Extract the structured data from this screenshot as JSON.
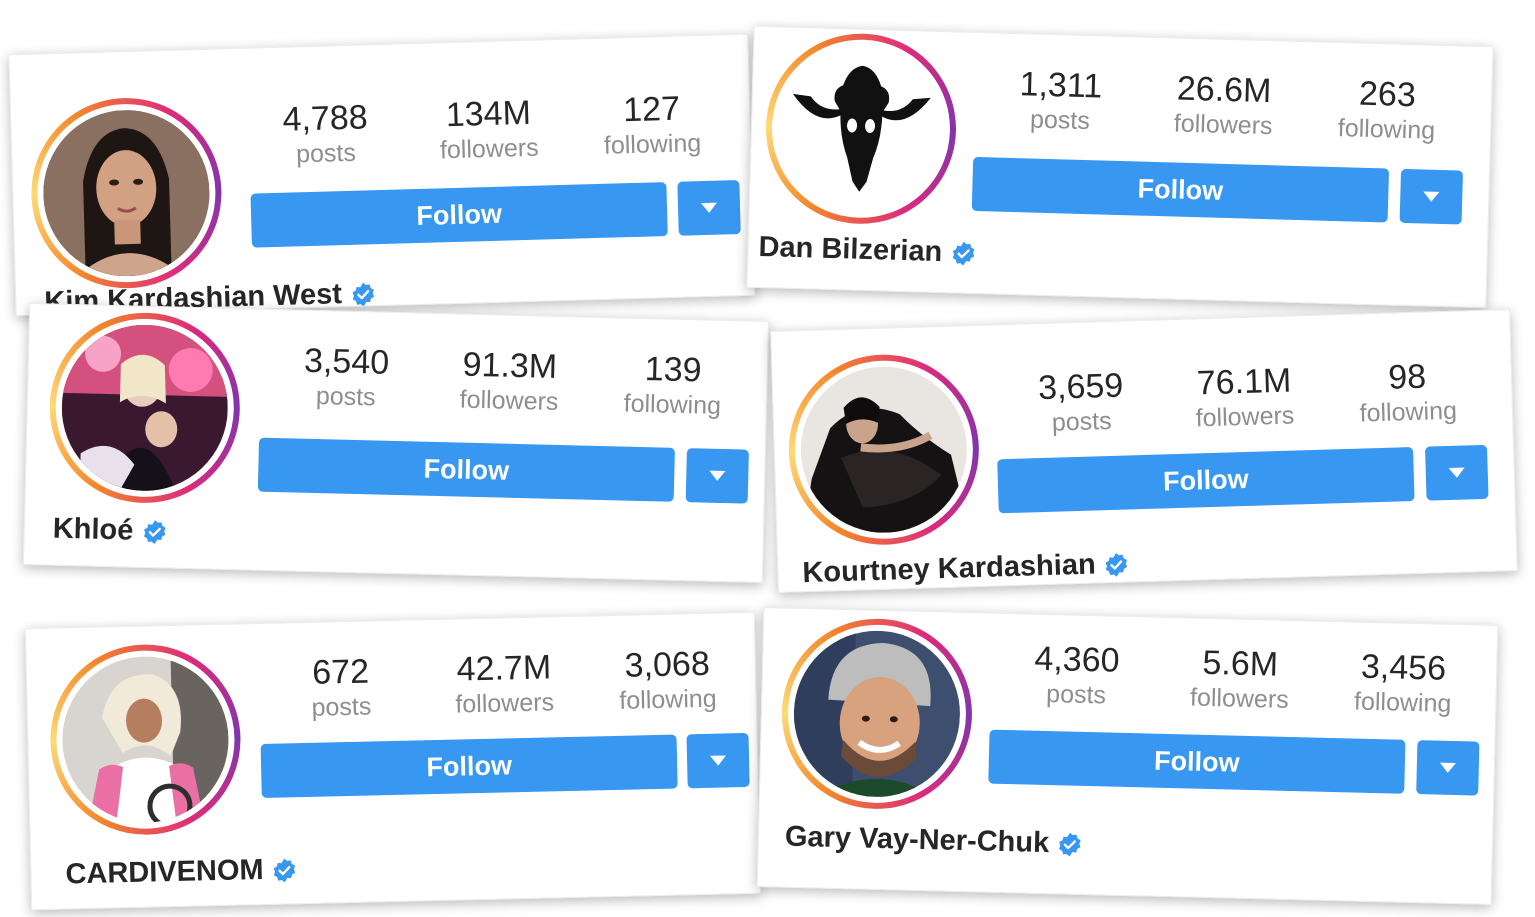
{
  "colors": {
    "follow_blue": "#3897f0",
    "verified_blue": "#3897f0",
    "text_dark": "#262626",
    "text_muted": "#8e8e8e"
  },
  "labels": {
    "posts": "posts",
    "followers": "followers",
    "following": "following",
    "follow": "Follow"
  },
  "profiles": [
    {
      "name": "Kim Kardashian West",
      "verified": true,
      "posts": "4,788",
      "followers": "134M",
      "following": "127",
      "avatar_icon": "portrait-photo"
    },
    {
      "name": "Dan Bilzerian",
      "verified": true,
      "posts": "1,311",
      "followers": "26.6M",
      "following": "263",
      "avatar_icon": "goat-skull-logo"
    },
    {
      "name": "Khloé",
      "verified": true,
      "posts": "3,540",
      "followers": "91.3M",
      "following": "139",
      "avatar_icon": "portrait-photo"
    },
    {
      "name": "Kourtney Kardashian",
      "verified": true,
      "posts": "3,659",
      "followers": "76.1M",
      "following": "98",
      "avatar_icon": "portrait-photo"
    },
    {
      "name": "CARDIVENOM",
      "verified": true,
      "posts": "672",
      "followers": "42.7M",
      "following": "3,068",
      "avatar_icon": "portrait-photo"
    },
    {
      "name": "Gary Vay-Ner-Chuk",
      "verified": true,
      "posts": "4,360",
      "followers": "5.6M",
      "following": "3,456",
      "avatar_icon": "portrait-photo"
    }
  ]
}
